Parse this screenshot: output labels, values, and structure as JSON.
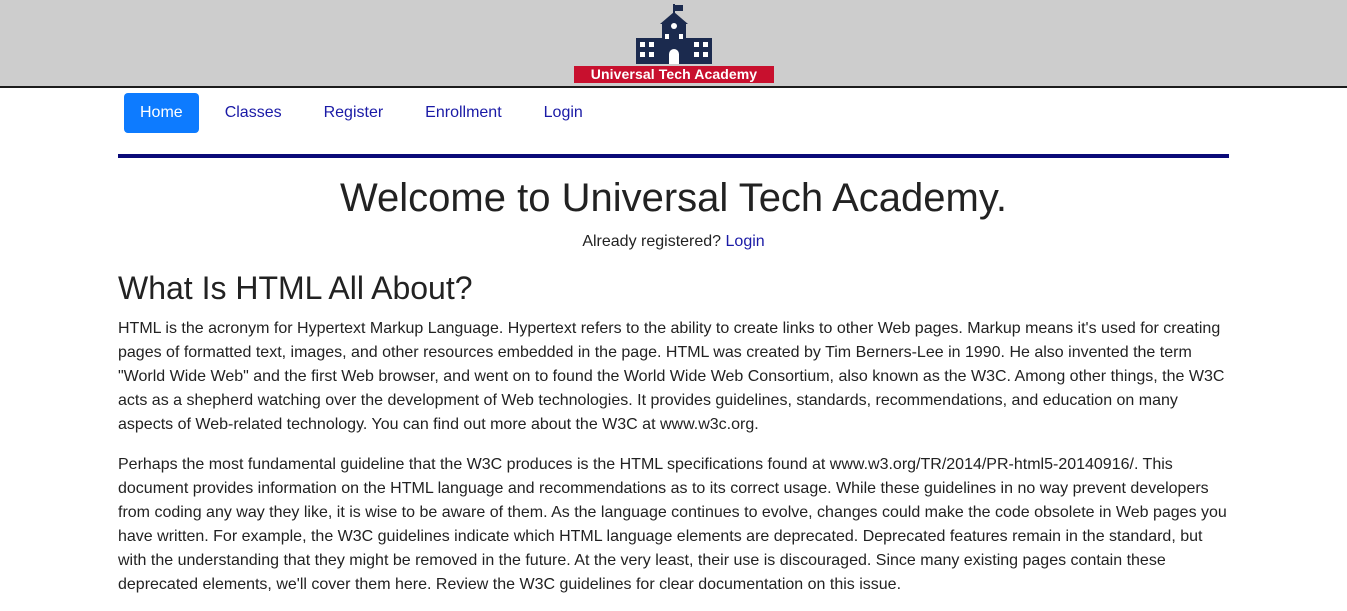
{
  "header": {
    "brand_text": "Universal Tech Academy",
    "logo_icon": "school-building-icon",
    "background_color": "#cdcdcd",
    "brand_color": "#c8102e",
    "building_color": "#1b2a4e"
  },
  "nav": {
    "items": [
      {
        "label": "Home",
        "active": true
      },
      {
        "label": "Classes",
        "active": false
      },
      {
        "label": "Register",
        "active": false
      },
      {
        "label": "Enrollment",
        "active": false
      },
      {
        "label": "Login",
        "active": false
      }
    ],
    "active_color": "#0d7bff",
    "link_color": "#1a1aa6"
  },
  "main": {
    "welcome_title": "Welcome to Universal Tech Academy.",
    "already_registered_text": "Already registered?",
    "login_link": "Login",
    "section_heading": "What Is HTML All About?",
    "paragraphs": [
      "HTML is the acronym for Hypertext Markup Language. Hypertext refers to the ability to create links to other Web pages. Markup means it's used for creating pages of formatted text, images, and other resources embedded in the page. HTML was created by Tim Berners-Lee in 1990. He also invented the term \"World Wide Web\" and the first Web browser, and went on to found the World Wide Web Consortium, also known as the W3C. Among other things, the W3C acts as a shepherd watching over the development of Web technologies. It provides guidelines, standards, recommendations, and education on many aspects of Web-related technology. You can find out more about the W3C at www.w3c.org.",
      "Perhaps the most fundamental guideline that the W3C produces is the HTML specifications found at www.w3.org/TR/2014/PR-html5-20140916/. This document provides information on the HTML language and recommendations as to its correct usage. While these guidelines in no way prevent developers from coding any way they like, it is wise to be aware of them. As the language continues to evolve, changes could make the code obsolete in Web pages you have written. For example, the W3C guidelines indicate which HTML language elements are deprecated. Deprecated features remain in the standard, but with the understanding that they might be removed in the future. At the very least, their use is discouraged. Since many existing pages contain these deprecated elements, we'll cover them here. Review the W3C guidelines for clear documentation on this issue."
    ],
    "rule_color": "#0a0a78"
  }
}
